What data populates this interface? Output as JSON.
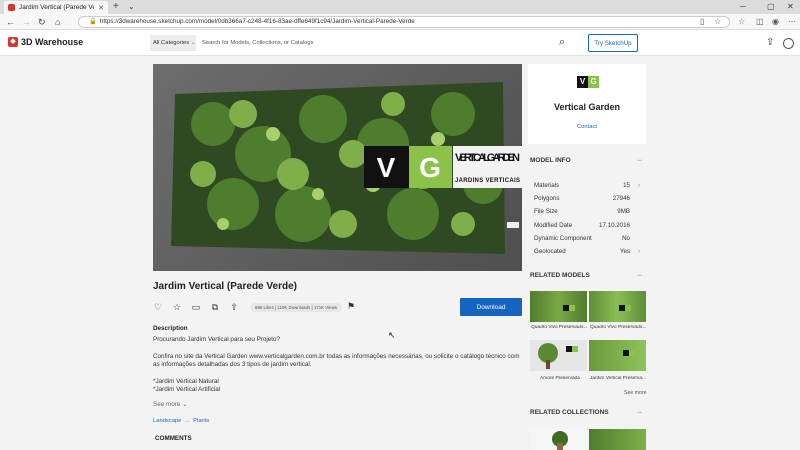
{
  "browser": {
    "tab_title": "Jardim Vertical (Parede Verde",
    "url": "https://3dwarehouse.sketchup.com/model/0db366a7-c248-4f16-83ae-dffe649f1c94/Jardim-Vertical-Parede-Verde"
  },
  "header": {
    "logo_text": "3D Warehouse",
    "category_label": "All Categories",
    "search_placeholder": "Search for Models, Collections, or Catalogs",
    "try_label": "Try SketchUp"
  },
  "model": {
    "title": "Jardim Vertical (Parede Verde)",
    "stats": "686 Likes | 110K Downloads | 171K Views",
    "download_label": "Download",
    "overlay_logo": "VERTICAL GARDEN",
    "overlay_sub": "JARDINS VERTICAIS"
  },
  "description": {
    "heading": "Description",
    "line1": "Procurando Jardim Vertical para seu Projeto?",
    "line2": "Confira no site da Vertical Garden www.verticalgarden.com.br todas as informações necessárias, ou solicite o catálogo técnico com as informações detalhadas dos 3 tipos de jardim vertical.",
    "line3": "*Jardim Vertical Natural",
    "line4": "*Jardim Vertical Artificial",
    "see_more": "See more"
  },
  "breadcrumb": {
    "cat1": "Landscape",
    "cat2": "Plants"
  },
  "comments_heading": "COMMENTS",
  "brand": {
    "v": "V",
    "g": "G",
    "name": "Vertical Garden",
    "contact": "Contact"
  },
  "model_info": {
    "heading": "MODEL INFO",
    "rows": [
      {
        "label": "Materials",
        "value": "15"
      },
      {
        "label": "Polygons",
        "value": "27946"
      },
      {
        "label": "File Size",
        "value": "9MB"
      },
      {
        "label": "Modified Date",
        "value": "17.10.2016"
      },
      {
        "label": "Dynamic Component",
        "value": "No"
      },
      {
        "label": "Geolocated",
        "value": "Yes"
      }
    ]
  },
  "related_models": {
    "heading": "RELATED MODELS",
    "items": [
      {
        "label": "Quadro Vivo Preservado..."
      },
      {
        "label": "Quadro Vivo Preservado..."
      },
      {
        "label": "Árvore Preservada"
      },
      {
        "label": "Jardim Vertical Preserva..."
      }
    ],
    "see_more": "See more"
  },
  "related_collections": {
    "heading": "RELATED COLLECTIONS"
  },
  "colors": {
    "accent": "#1565c0",
    "brand_green": "#8bc34a",
    "logo_red": "#d9342b"
  }
}
